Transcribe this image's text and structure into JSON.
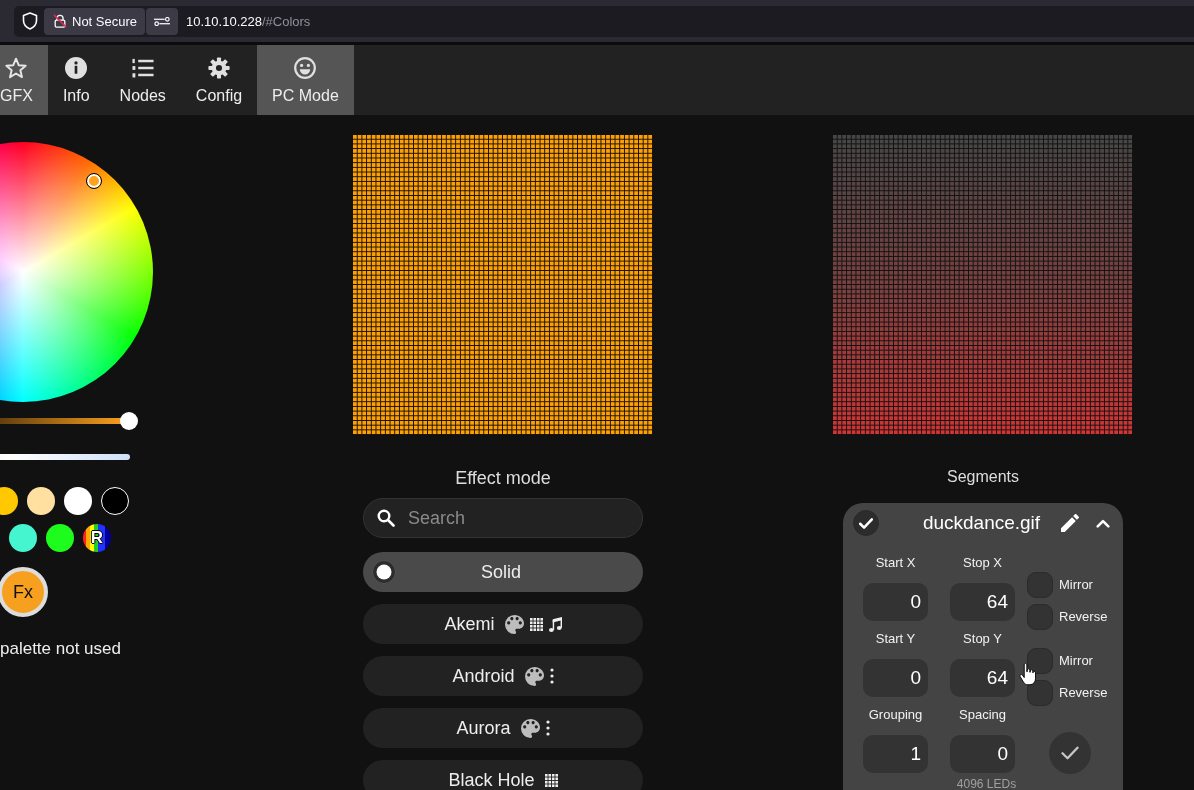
{
  "browser": {
    "security_label": "Not Secure",
    "url_host": "10.10.10.228",
    "url_path": "/#Colors"
  },
  "top_nav": [
    {
      "kind": "gfx",
      "label": "GFX",
      "on": true
    },
    {
      "kind": "info",
      "label": "Info",
      "on": false
    },
    {
      "kind": "nodes",
      "label": "Nodes",
      "on": false
    },
    {
      "kind": "config",
      "label": "Config",
      "on": false
    },
    {
      "kind": "pc_mode",
      "label": "PC Mode",
      "on": true
    }
  ],
  "color_panel": {
    "brightness": {
      "level": 1
    },
    "quick_colors": [
      [
        {
          "kind": "color",
          "color": "#ffc800"
        },
        {
          "kind": "color",
          "color": "#ffe0a0"
        },
        {
          "kind": "color",
          "color": "#ffffff"
        },
        {
          "kind": "color",
          "color": "#000000"
        }
      ],
      [
        {
          "kind": "color",
          "color": "#45f5cf"
        },
        {
          "kind": "color",
          "color": "#1dfc1d"
        },
        {
          "kind": "random",
          "label": "R"
        }
      ]
    ],
    "fx_button": {
      "label": "Fx"
    },
    "palette_note": "palette not used"
  },
  "effects": {
    "title": "Effect mode",
    "search": {
      "placeholder": "Search"
    },
    "items": [
      {
        "name": "Solid",
        "selected": true,
        "palette": false,
        "one_d": false,
        "two_d": false,
        "audio": false
      },
      {
        "name": "Akemi",
        "selected": false,
        "palette": true,
        "one_d": false,
        "two_d": true,
        "audio": true
      },
      {
        "name": "Android",
        "selected": false,
        "palette": true,
        "one_d": true,
        "two_d": false,
        "audio": false
      },
      {
        "name": "Aurora",
        "selected": false,
        "palette": true,
        "one_d": true,
        "two_d": false,
        "audio": false
      },
      {
        "name": "Black Hole",
        "selected": false,
        "palette": false,
        "one_d": false,
        "two_d": true,
        "audio": false
      }
    ]
  },
  "segments": {
    "title": "Segments",
    "items": [
      {
        "name": "duckdance.gif",
        "checked": true,
        "expanded": true,
        "axes": [
          {
            "fields": [
              {
                "label": "Start X",
                "value": "0"
              },
              {
                "label": "Stop X",
                "value": "64"
              }
            ],
            "options": [
              {
                "label": "Mirror",
                "checked": false
              },
              {
                "label": "Reverse",
                "checked": false
              }
            ]
          },
          {
            "fields": [
              {
                "label": "Start Y",
                "value": "0"
              },
              {
                "label": "Stop Y",
                "value": "64"
              }
            ],
            "options": [
              {
                "label": "Mirror",
                "checked": false
              },
              {
                "label": "Reverse",
                "checked": false
              }
            ]
          }
        ],
        "spacing_fields": [
          {
            "label": "Grouping",
            "value": "1"
          },
          {
            "label": "Spacing",
            "value": "0"
          }
        ],
        "led_count": "4096 LEDs"
      }
    ]
  }
}
